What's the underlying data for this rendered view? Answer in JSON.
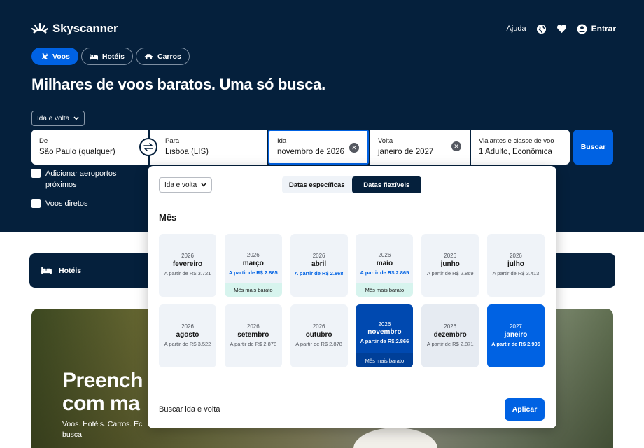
{
  "brand": {
    "name": "Skyscanner"
  },
  "header": {
    "help": "Ajuda",
    "login": "Entrar"
  },
  "tabs": [
    {
      "label": "Voos",
      "active": true
    },
    {
      "label": "Hotéis",
      "active": false
    },
    {
      "label": "Carros",
      "active": false
    }
  ],
  "headline": "Milhares de voos baratos. Uma só busca.",
  "search": {
    "trip_type": "Ida e volta",
    "from": {
      "label": "De",
      "value": "São Paulo (qualquer)"
    },
    "to": {
      "label": "Para",
      "value": "Lisboa (LIS)"
    },
    "depart": {
      "label": "Ida",
      "value": "novembro de 2026"
    },
    "return": {
      "label": "Volta",
      "value": "janeiro de 2027"
    },
    "travellers": {
      "label": "Viajantes e classe de voo",
      "value": "1 Adulto, Econômica"
    },
    "submit": "Buscar"
  },
  "options": {
    "nearby_line1": "Adicionar aeroportos",
    "nearby_line2": "próximos",
    "direct": "Voos diretos"
  },
  "hotels_bar": {
    "label": "Hotéis"
  },
  "promo": {
    "title_line1": "Preench",
    "title_line2": "com ma",
    "sub_line1": "Voos. Hotéis. Carros. Ec",
    "sub_line2": "busca."
  },
  "datepicker": {
    "trip_type": "Ida e volta",
    "seg_specific": "Datas específicas",
    "seg_flexible": "Datas flexíveis",
    "section_title": "Mês",
    "months": [
      {
        "year": "2026",
        "name": "fevereiro",
        "price": "A partir de R$ 3.721",
        "tag": ""
      },
      {
        "year": "2026",
        "name": "março",
        "price": "A partir de R$ 2.865",
        "tag": "Mês mais barato"
      },
      {
        "year": "2026",
        "name": "abril",
        "price": "A partir de R$ 2.868",
        "tag": ""
      },
      {
        "year": "2026",
        "name": "maio",
        "price": "A partir de R$ 2.865",
        "tag": "Mês mais barato"
      },
      {
        "year": "2026",
        "name": "junho",
        "price": "A partir de R$ 2.869",
        "tag": ""
      },
      {
        "year": "2026",
        "name": "julho",
        "price": "A partir de R$ 3.413",
        "tag": ""
      },
      {
        "year": "2026",
        "name": "agosto",
        "price": "A partir de R$ 3.522",
        "tag": ""
      },
      {
        "year": "2026",
        "name": "setembro",
        "price": "A partir de R$ 2.878",
        "tag": ""
      },
      {
        "year": "2026",
        "name": "outubro",
        "price": "A partir de R$ 2.878",
        "tag": ""
      },
      {
        "year": "2026",
        "name": "novembro",
        "price": "A partir de R$ 2.866",
        "tag": "Mês mais barato"
      },
      {
        "year": "2026",
        "name": "dezembro",
        "price": "A partir de R$ 2.871",
        "tag": ""
      },
      {
        "year": "2027",
        "name": "janeiro",
        "price": "A partir de R$ 2.905",
        "tag": ""
      }
    ],
    "footer_text": "Buscar ida e volta",
    "apply": "Aplicar"
  },
  "colors": {
    "navy": "#05203c",
    "blue": "#0062e3",
    "cheap_tag": "#d7f4ee"
  }
}
